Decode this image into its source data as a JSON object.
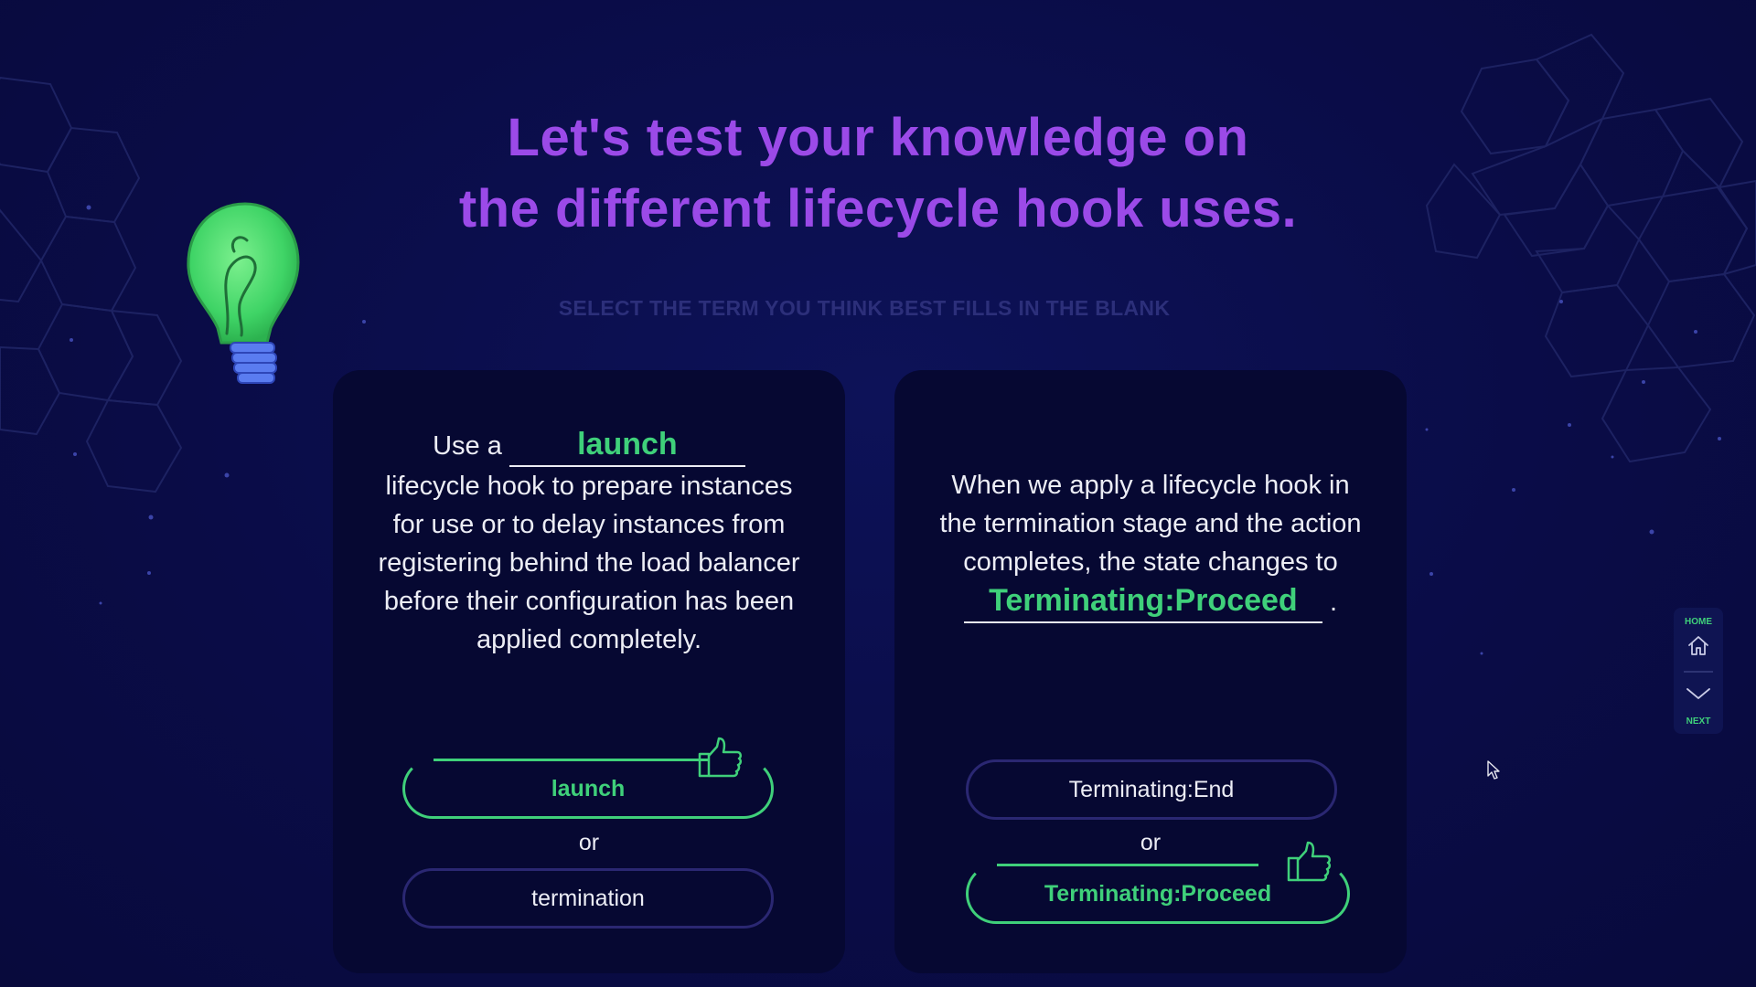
{
  "heading": {
    "line1": "Let's test your knowledge on",
    "line2": "the different lifecycle hook uses."
  },
  "instruction": "SELECT THE TERM YOU THINK BEST FILLS IN THE BLANK",
  "cards": [
    {
      "prefix": "Use a",
      "answer": "launch",
      "suffix": "lifecycle hook to prepare instances for use or to delay instances from registering behind the load balancer before their configuration has been applied completely.",
      "option_a": "launch",
      "or_label": "or",
      "option_b": "termination",
      "correct_option": "a"
    },
    {
      "prefix": "When we apply a lifecycle hook in the termination stage and the action completes, the state changes to",
      "answer": "Terminating:Proceed",
      "suffix": ".",
      "option_a": "Terminating:End",
      "or_label": "or",
      "option_b": "Terminating:Proceed",
      "correct_option": "b"
    }
  ],
  "nav": {
    "home_label": "HOME",
    "next_label": "NEXT",
    "home_icon": "home-icon",
    "next_icon": "chevron-down-icon"
  },
  "colors": {
    "background": "#0a0c47",
    "card": "#060832",
    "title": "#9b4ae8",
    "accent_green": "#3fd07a",
    "button_border": "#2a2772"
  }
}
